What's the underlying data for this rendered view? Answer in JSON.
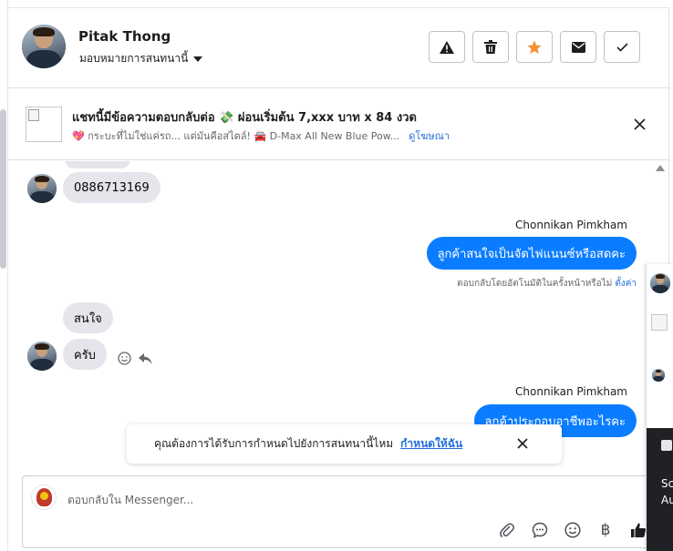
{
  "header": {
    "name": "Pitak Thong",
    "assign_label": "มอบหมายการสนทนานี้",
    "actions": [
      {
        "icon": "warning-icon"
      },
      {
        "icon": "trash-icon"
      },
      {
        "icon": "star-icon",
        "color": "#f7923a"
      },
      {
        "icon": "envelope-icon"
      },
      {
        "icon": "check-icon"
      }
    ]
  },
  "ad": {
    "title": "แชทนี้มีข้อความตอบกลับต่อ 💸 ผ่อนเริ่มต้น 7,xxx บาท x 84 งวด",
    "subtitle": "💖 กระบะที่ไม่ใช่แค่รถ... แต่มันคือสไตล์! 🚘 D-Max All New Blue Pow...",
    "link": "ดูโฆษณา"
  },
  "messages": {
    "phone": "0886713169",
    "agent_name_1": "Chonnikan Pimkham",
    "out_1": "ลูกค้าสนใจเป็นจัดไฟแนนซ์หรือสดคะ",
    "auto_reply_note": "ตอบกลับโดยอัตโนมัติในครั้งหน้าหรือไม่",
    "auto_reply_link": "ตั้งค่า",
    "in_interest": "สนใจ",
    "in_krab": "ครับ",
    "agent_name_2": "Chonnikan Pimkham",
    "out_2": "ลูกค้าประกอบอาชีพอะไรคะ"
  },
  "toast": {
    "text": "คุณต้องการได้รับการกำหนดไปยังการสนทนานี้ไหม",
    "link": "กำหนดให้ฉัน"
  },
  "composer": {
    "placeholder": "ตอบกลับใน Messenger...",
    "tools": [
      "paperclip-icon",
      "chat-bubble-icon",
      "emoji-icon",
      "baht-icon",
      "thumbs-up-icon"
    ],
    "baht_symbol": "฿"
  },
  "side_panel": {
    "text_1": "Sc",
    "text_2": "Au"
  },
  "colors": {
    "accent": "#0a7cff",
    "link": "#216fdb",
    "star": "#f7923a"
  }
}
